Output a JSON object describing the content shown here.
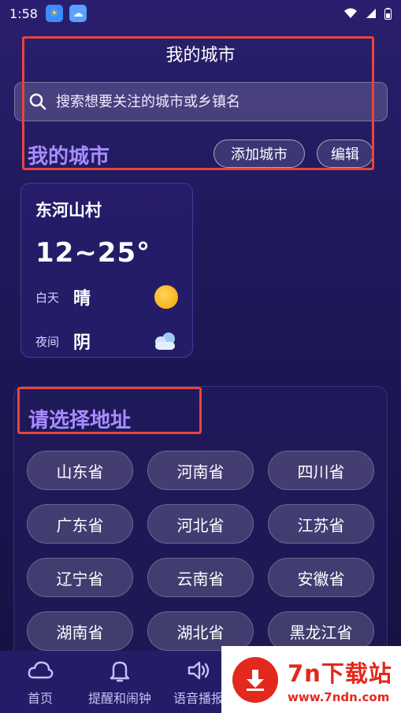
{
  "status_bar": {
    "time": "1:58"
  },
  "header": {
    "title": "我的城市"
  },
  "search": {
    "placeholder": "搜索想要关注的城市或乡镇名"
  },
  "my_cities": {
    "title": "我的城市",
    "add_label": "添加城市",
    "edit_label": "编辑",
    "cards": [
      {
        "name": "东河山村",
        "temp_range": "12~25°",
        "day_label": "白天",
        "day_condition": "晴",
        "day_icon": "sun-icon",
        "night_label": "夜间",
        "night_condition": "阴",
        "night_icon": "cloud-icon"
      }
    ]
  },
  "region": {
    "title": "请选择地址",
    "provinces": [
      "山东省",
      "河南省",
      "四川省",
      "广东省",
      "河北省",
      "江苏省",
      "辽宁省",
      "云南省",
      "安徽省",
      "湖南省",
      "湖北省",
      "黑龙江省"
    ]
  },
  "bottom_nav": {
    "items": [
      {
        "label": "首页",
        "icon": "cloud-icon"
      },
      {
        "label": "提醒和闹钟",
        "icon": "bell-icon"
      },
      {
        "label": "语音播报",
        "icon": "speaker-icon"
      }
    ]
  },
  "watermark": {
    "title": "7n下载站",
    "url": "www.7ndn.com"
  },
  "colors": {
    "accent": "#a98cff",
    "highlight": "#e8453c",
    "watermark": "#e3281c"
  }
}
